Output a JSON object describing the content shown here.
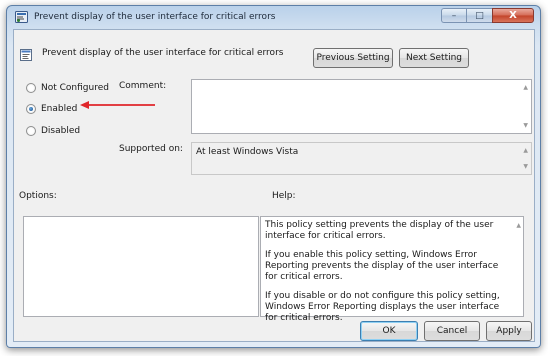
{
  "window": {
    "title": "Prevent display of the user interface for critical errors",
    "minimize_glyph": "–",
    "maximize_glyph": "□",
    "close_glyph": "X"
  },
  "header": {
    "title": "Prevent display of the user interface for critical errors",
    "previous_label": "Previous Setting",
    "next_label": "Next Setting"
  },
  "state": {
    "options": [
      {
        "label": "Not Configured",
        "checked": false
      },
      {
        "label": "Enabled",
        "checked": true
      },
      {
        "label": "Disabled",
        "checked": false
      }
    ]
  },
  "comment": {
    "label": "Comment:",
    "value": ""
  },
  "supported_on": {
    "label": "Supported on:",
    "value": "At least Windows Vista"
  },
  "options_section": {
    "label": "Options:"
  },
  "help": {
    "label": "Help:",
    "paragraphs": [
      "This policy setting prevents the display of the user interface for critical errors.",
      "If you enable this policy setting, Windows Error Reporting prevents the display of the user interface for critical errors.",
      "If you disable or do not configure this policy setting, Windows Error Reporting displays the user interface for critical errors."
    ]
  },
  "footer": {
    "ok_label": "OK",
    "cancel_label": "Cancel",
    "apply_label": "Apply"
  },
  "colors": {
    "annotation_arrow": "#e0262b",
    "title_bar": "#b9d1ea",
    "close_button": "#c2432a"
  },
  "icons": {
    "window": "policy-icon",
    "header": "setting-icon",
    "arrow": "red-arrow-annotation"
  }
}
